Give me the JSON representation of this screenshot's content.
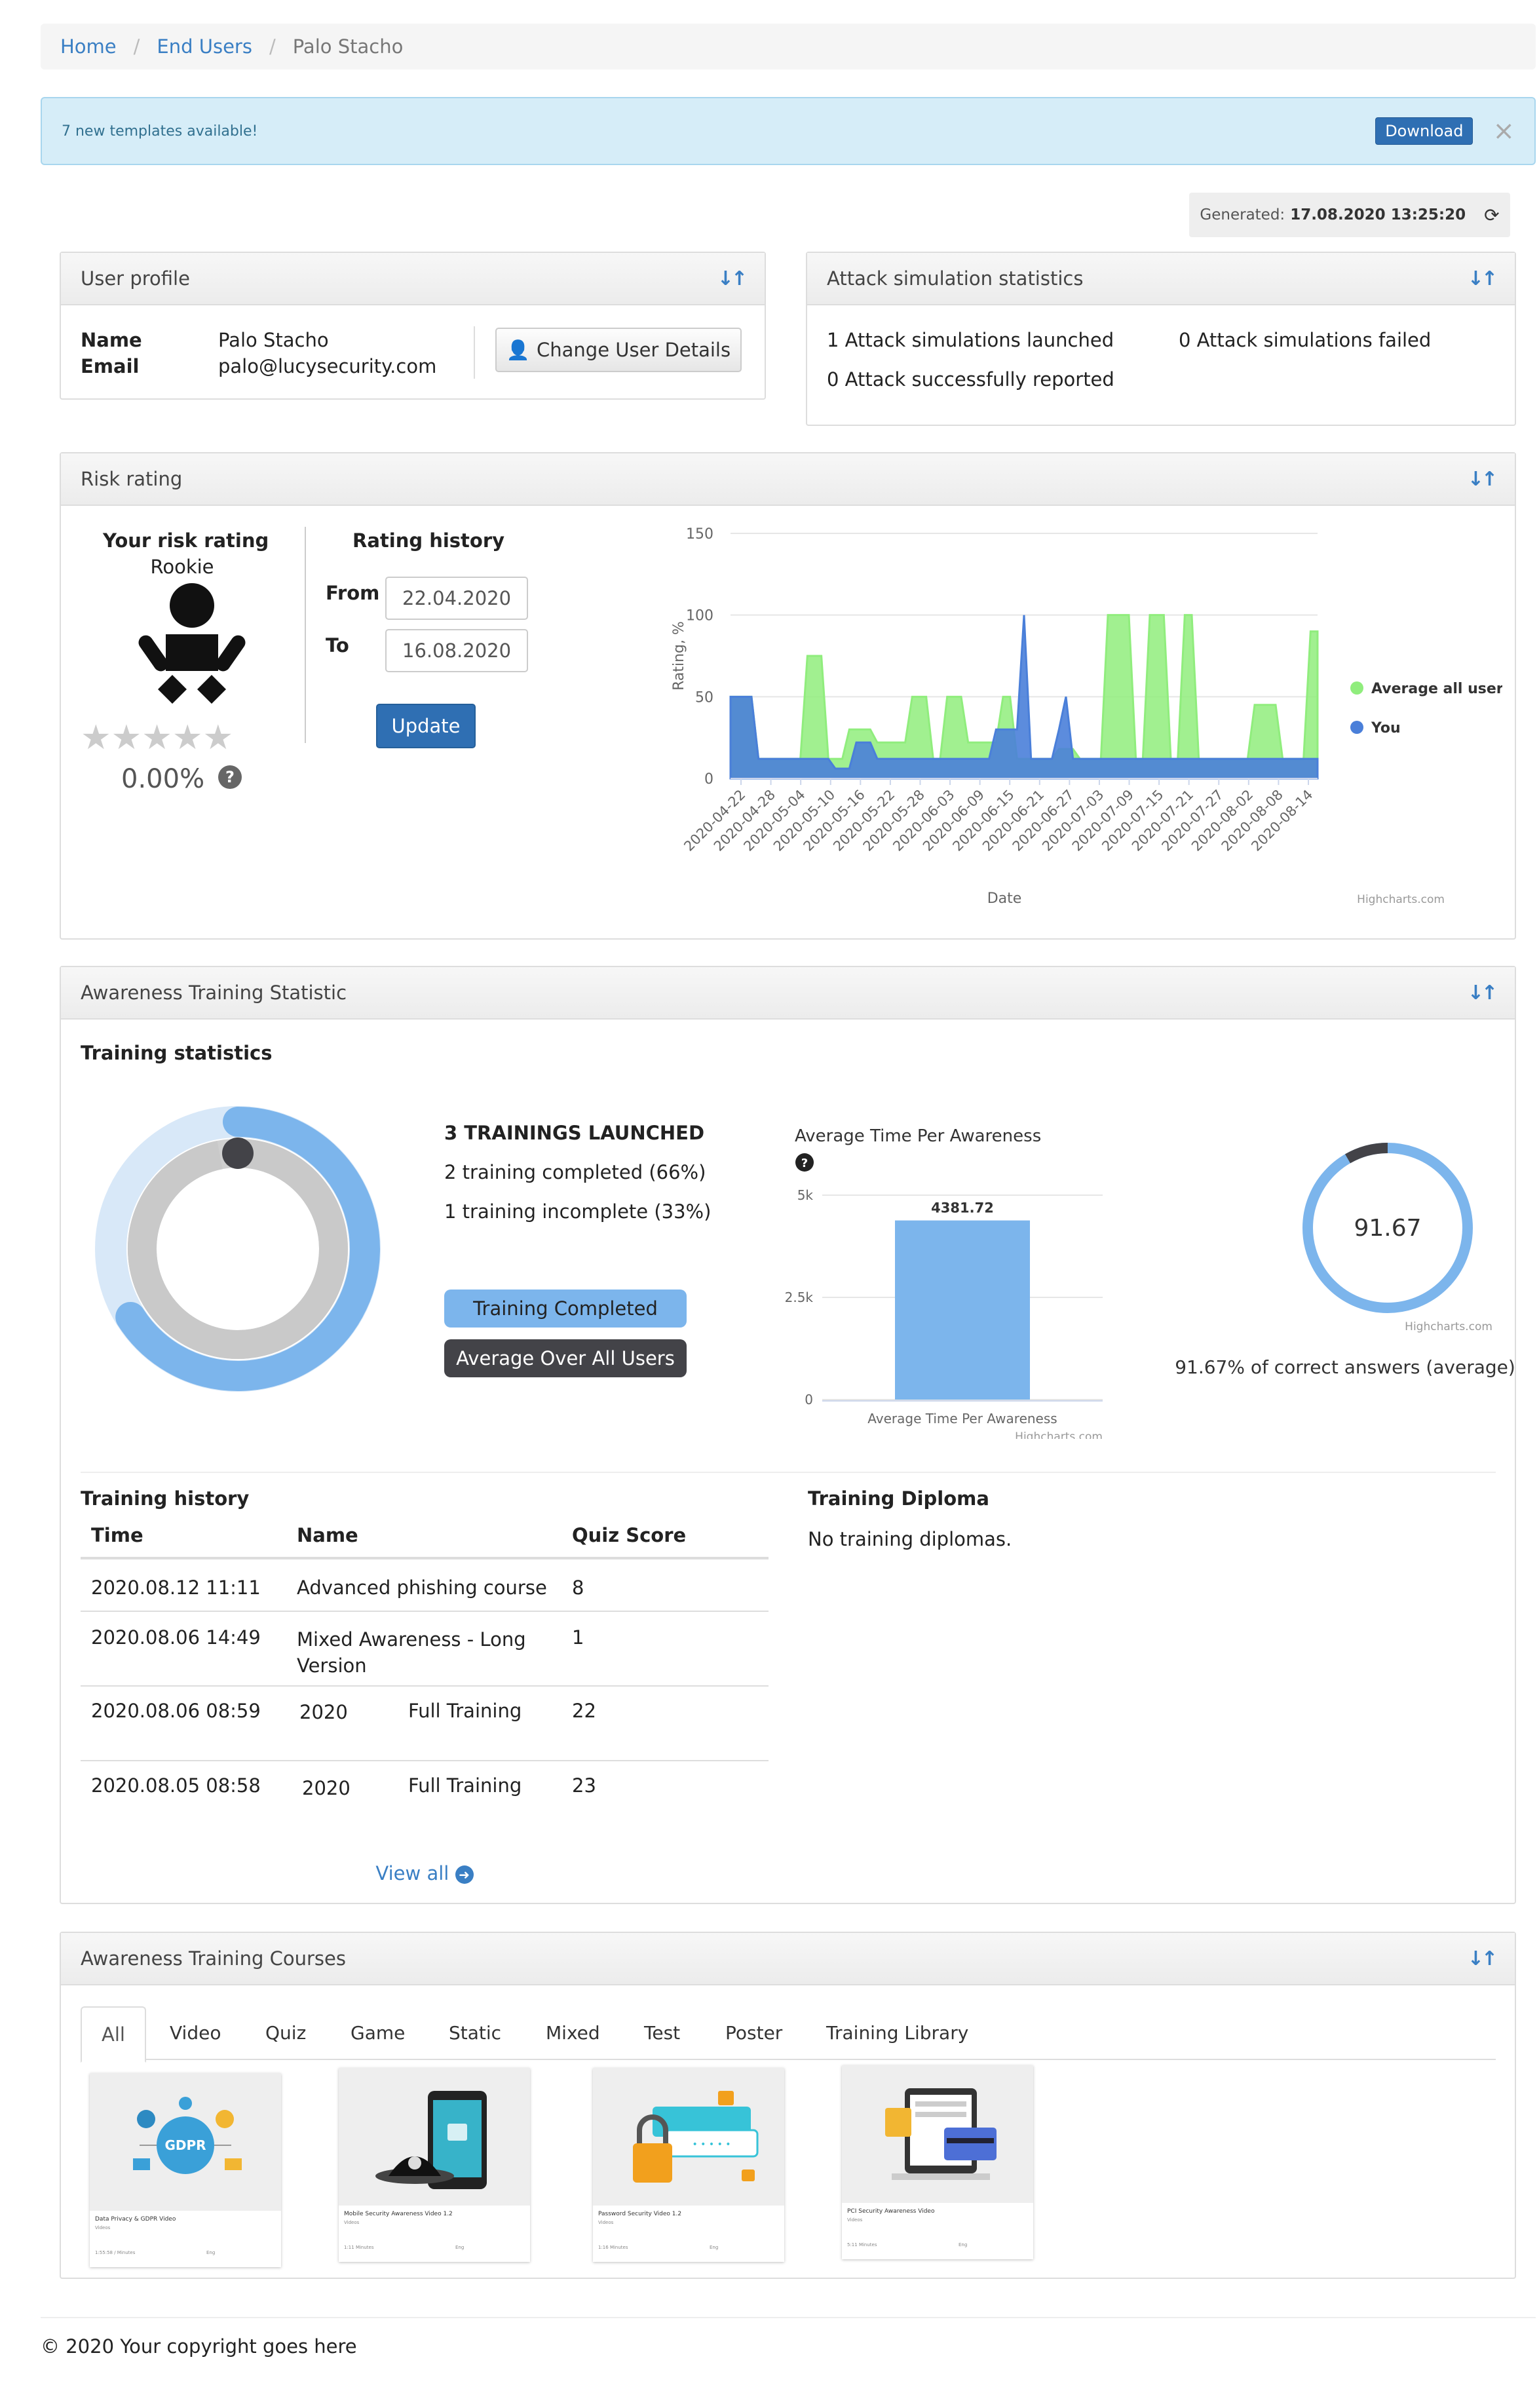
{
  "breadcrumb": {
    "home": "Home",
    "end_users": "End Users",
    "current": "Palo Stacho"
  },
  "alert": {
    "text": "7 new templates available!",
    "download_label": "Download",
    "close_symbol": "×"
  },
  "generated": {
    "label": "Generated:",
    "value": "17.08.2020 13:25:20",
    "refresh_icon": "refresh-icon"
  },
  "user_profile": {
    "title": "User profile",
    "name_label": "Name",
    "name_value": "Palo Stacho",
    "email_label": "Email",
    "email_value": "palo@lucysecurity.com",
    "change_button": "Change User Details"
  },
  "attack_stats": {
    "title": "Attack simulation statistics",
    "launched": "1 Attack simulations launched",
    "failed": "0 Attack simulations failed",
    "reported": "0 Attack successfully reported"
  },
  "risk": {
    "title": "Risk rating",
    "your_rating_label": "Your risk rating",
    "level": "Rookie",
    "stars_filled": 0,
    "stars_total": 5,
    "percent": "0.00%",
    "history_title": "Rating history",
    "from_label": "From",
    "from_value": "22.04.2020",
    "to_label": "To",
    "to_value": "16.08.2020",
    "update_button": "Update",
    "credit": "Highcharts.com"
  },
  "chart_data": [
    {
      "type": "area",
      "title": "",
      "xlabel": "Date",
      "ylabel": "Rating, %",
      "ylim": [
        0,
        150
      ],
      "yticks": [
        "0",
        "50",
        "100",
        "150"
      ],
      "xtick_labels": [
        "2020-04-22",
        "2020-04-28",
        "2020-05-04",
        "2020-05-10",
        "2020-05-16",
        "2020-05-22",
        "2020-05-28",
        "2020-06-03",
        "2020-06-09",
        "2020-06-15",
        "2020-06-21",
        "2020-06-27",
        "2020-07-03",
        "2020-07-09",
        "2020-07-15",
        "2020-07-21",
        "2020-07-27",
        "2020-08-02",
        "2020-08-08",
        "2020-08-14"
      ],
      "legend_position": "right",
      "grid": true,
      "series": [
        {
          "name": "Average all users",
          "color": "#90ed7d",
          "values": [
            50,
            50,
            50,
            50,
            12,
            12,
            12,
            12,
            12,
            12,
            12,
            75,
            75,
            75,
            12,
            12,
            12,
            30,
            30,
            30,
            30,
            22,
            22,
            22,
            22,
            22,
            50,
            50,
            50,
            12,
            12,
            50,
            50,
            50,
            22,
            22,
            22,
            22,
            22,
            50,
            50,
            12,
            12,
            12,
            12,
            12,
            12,
            18,
            18,
            18,
            12,
            12,
            12,
            12,
            100,
            100,
            100,
            100,
            12,
            12,
            100,
            100,
            100,
            12,
            12,
            100,
            100,
            12,
            12,
            12,
            12,
            12,
            12,
            12,
            12,
            45,
            45,
            45,
            45,
            12,
            12,
            12,
            12,
            90,
            90
          ]
        },
        {
          "name": "You",
          "color": "#4a7fd9",
          "values": [
            50,
            50,
            50,
            50,
            12,
            12,
            12,
            12,
            12,
            12,
            12,
            12,
            12,
            12,
            12,
            6,
            6,
            6,
            22,
            22,
            22,
            12,
            12,
            12,
            12,
            12,
            12,
            12,
            12,
            12,
            12,
            12,
            12,
            12,
            12,
            12,
            12,
            12,
            30,
            30,
            30,
            30,
            100,
            12,
            12,
            12,
            12,
            30,
            50,
            12,
            12,
            12,
            12,
            12,
            12,
            12,
            12,
            12,
            12,
            12,
            12,
            12,
            12,
            12,
            12,
            12,
            12,
            12,
            12,
            12,
            12,
            12,
            12,
            12,
            12,
            12,
            12,
            12,
            12,
            12,
            12,
            12,
            12,
            12,
            12
          ]
        }
      ]
    },
    {
      "type": "pie",
      "title": "",
      "legend": [
        "Training Completed",
        "Average Over All Users"
      ],
      "series": [
        {
          "name": "Training Completed",
          "color": "#7cb5ec",
          "value": 66,
          "total": 100
        },
        {
          "name": "Average Over All Users",
          "color": "#434348",
          "value": 97,
          "total": 100
        }
      ]
    },
    {
      "type": "bar",
      "title": "Average Time Per Awareness",
      "categories": [
        "Average Time Per Awareness"
      ],
      "values": [
        4381.72
      ],
      "ylim": [
        0,
        5000
      ],
      "yticks": [
        "0",
        "2.5k",
        "5k"
      ],
      "data_label": "4381.72",
      "color": "#7cb5ec"
    },
    {
      "type": "pie",
      "title": "",
      "center_label": "91.67",
      "value": 91.67,
      "colors": [
        "#7cb5ec",
        "#434348"
      ],
      "caption": "91.67% of correct answers (average)"
    }
  ],
  "awareness_stat": {
    "title": "Awareness Training Statistic",
    "training_stats_title": "Training statistics",
    "launched": "3 TRAININGS LAUNCHED",
    "completed": "2 training completed (66%)",
    "incomplete": "1 training incomplete (33%)",
    "legend_completed": "Training Completed",
    "legend_average": "Average Over All Users",
    "credit": "Highcharts.com",
    "history_title": "Training history",
    "columns": [
      "Time",
      "Name",
      "Quiz Score"
    ],
    "rows": [
      {
        "time": "2020.08.12 11:11",
        "name": "Advanced phishing course",
        "name2": "",
        "score": "8"
      },
      {
        "time": "2020.08.06 14:49",
        "name": "Mixed Awareness - Long Version",
        "name2": "",
        "score": "1"
      },
      {
        "time": "2020.08.06 08:59",
        "name": "2020",
        "name2": "Full Training",
        "score": "22"
      },
      {
        "time": "2020.08.05 08:58",
        "name": "2020",
        "name2": "Full Training",
        "score": "23"
      }
    ],
    "view_all": "View all",
    "diploma_title": "Training Diploma",
    "diploma_text": "No training diplomas."
  },
  "courses": {
    "title": "Awareness Training Courses",
    "tabs": [
      "All",
      "Video",
      "Quiz",
      "Game",
      "Static",
      "Mixed",
      "Test",
      "Poster",
      "Training Library"
    ],
    "items": [
      {
        "title": "Data Privacy & GDPR Video",
        "type": "Videos",
        "duration": "1:55:58 / Minutes",
        "lang": "Eng"
      },
      {
        "title": "Mobile Security Awareness Video 1.2",
        "type": "Videos",
        "duration": "1:11 Minutes",
        "lang": "Eng"
      },
      {
        "title": "Password Security Video 1.2",
        "type": "Videos",
        "duration": "1:16 Minutes",
        "lang": "Eng"
      },
      {
        "title": "PCI Security Awareness Video",
        "type": "Videos",
        "duration": "5:11 Minutes",
        "lang": "Eng"
      }
    ]
  },
  "footer": {
    "text": "© 2020 Your copyright goes here"
  }
}
